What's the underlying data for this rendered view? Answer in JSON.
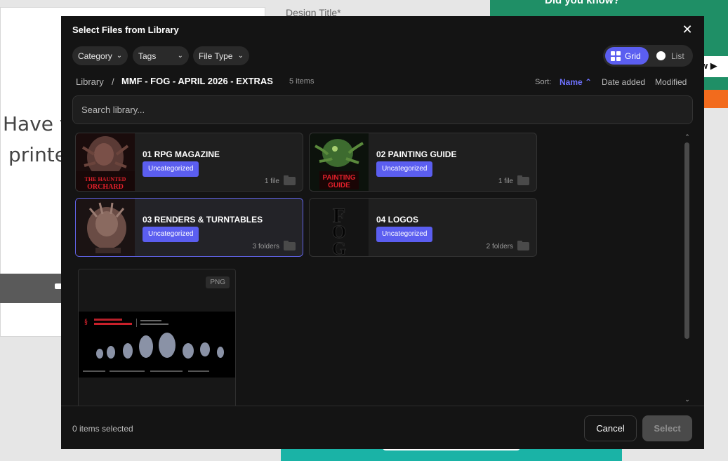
{
  "background": {
    "card_text_line1": "Have y",
    "card_text_line2": "printe",
    "form_label": "Design Title*",
    "banner_title": "Did you know?",
    "banner_button": "w"
  },
  "modal": {
    "title": "Select Files from Library",
    "filters": [
      {
        "label": "Category"
      },
      {
        "label": "Tags"
      },
      {
        "label": "File Type"
      }
    ],
    "view": {
      "grid_label": "Grid",
      "list_label": "List",
      "active": "Grid"
    },
    "breadcrumb": {
      "root": "Library",
      "separator": "/",
      "current": "MMF - FOG - APRIL 2026 - EXTRAS",
      "count": "5 items"
    },
    "sort": {
      "label": "Sort:",
      "options": [
        "Name",
        "Date added",
        "Modified"
      ],
      "active": "Name",
      "direction_icon": "chevron-up-icon"
    },
    "search": {
      "placeholder": "Search library..."
    },
    "folders": [
      {
        "name": "01 RPG MAGAZINE",
        "tag": "Uncategorized",
        "meta": "1 file",
        "thumb_text": "THE HAUNTED ORCHARD"
      },
      {
        "name": "02 PAINTING GUIDE",
        "tag": "Uncategorized",
        "meta": "1 file",
        "thumb_text": "PAINTING GUIDE"
      },
      {
        "name": "03 RENDERS & TURNTABLES",
        "tag": "Uncategorized",
        "meta": "3 folders"
      },
      {
        "name": "04 LOGOS",
        "tag": "Uncategorized",
        "meta": "2 folders",
        "thumb_text": "FOG"
      }
    ],
    "file": {
      "type_badge": "PNG"
    },
    "footer": {
      "selected_count": "0 items selected",
      "cancel_label": "Cancel",
      "select_label": "Select"
    },
    "colors": {
      "accent": "#5b5ef0",
      "background": "#141414",
      "card": "#1f1f1f"
    }
  }
}
